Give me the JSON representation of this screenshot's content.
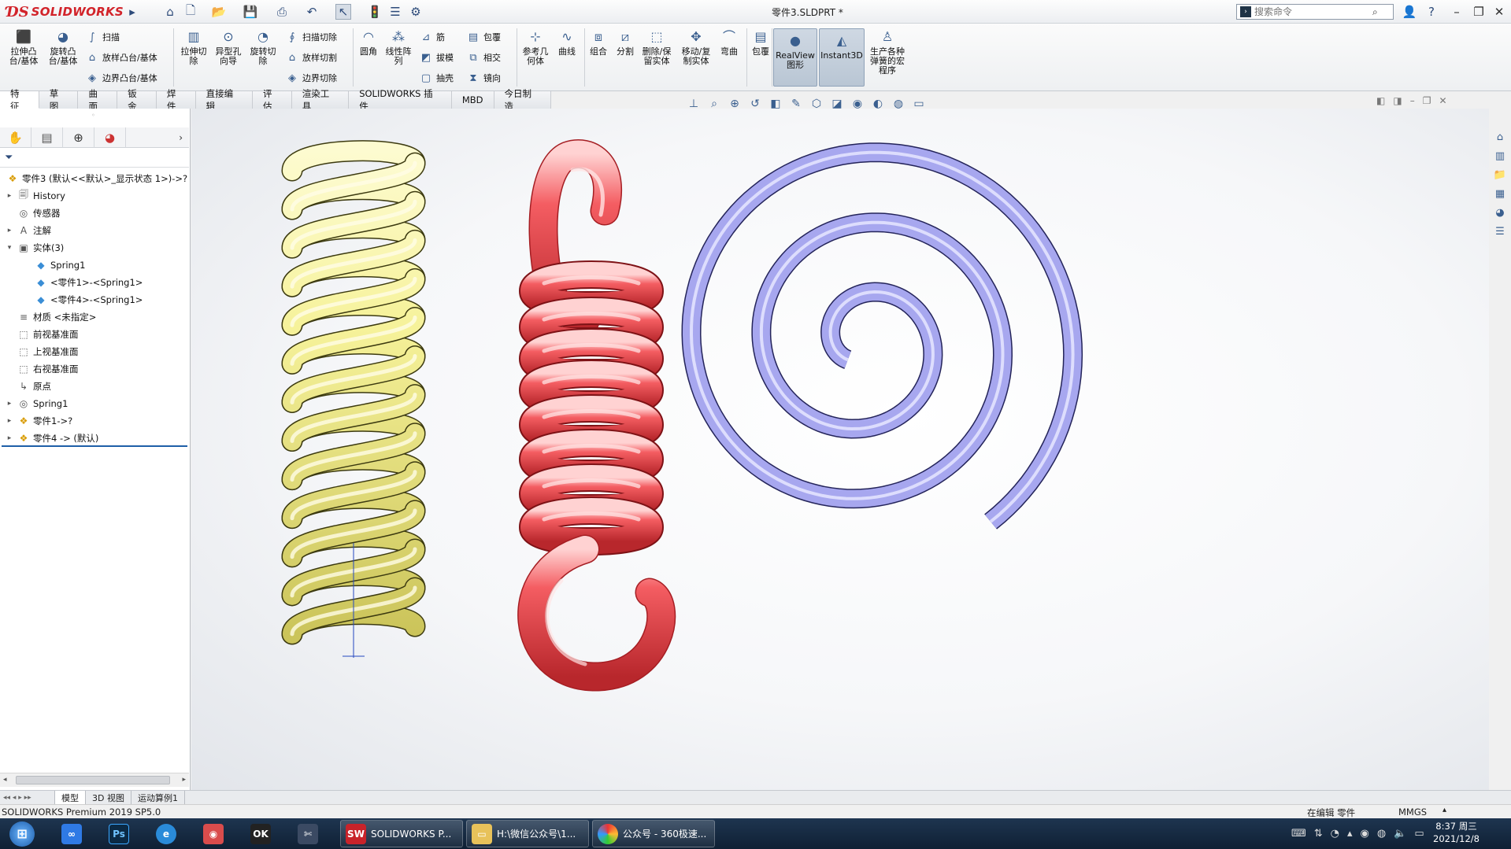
{
  "app": {
    "name": "SOLIDWORKS",
    "doc_title": "零件3.SLDPRT *"
  },
  "search": {
    "placeholder": "搜索命令"
  },
  "commands": {
    "extrude_boss": "拉伸凸台/基体",
    "revolve_boss": "旋转凸台/基体",
    "sweep": "扫描",
    "loft_boss": "放样凸台/基体",
    "boundary_boss": "边界凸台/基体",
    "extrude_cut": "拉伸切除",
    "hole_wizard": "异型孔向导",
    "revolve_cut": "旋转切除",
    "sweep_cut": "扫描切除",
    "loft_cut": "放样切割",
    "boundary_cut": "边界切除",
    "fillet": "圆角",
    "linear_pattern": "线性阵列",
    "rib": "筋",
    "draft": "拔模",
    "shell": "抽壳",
    "wrap": "包覆",
    "intersect": "相交",
    "mirror": "镜向",
    "ref_geometry": "参考几何体",
    "curves": "曲线",
    "combine": "组合",
    "split": "分割",
    "delete_keep_body": "删除/保留实体",
    "move_copy_body": "移动/复制实体",
    "flex": "弯曲",
    "wrap2": "包覆",
    "realview": "RealView图形",
    "instant3d": "Instant3D",
    "spring_program": "生产各种弹簧的宏程序"
  },
  "tabs": [
    "特征",
    "草图",
    "曲面",
    "钣金",
    "焊件",
    "直接编辑",
    "评估",
    "渲染工具",
    "SOLIDWORKS 插件",
    "MBD",
    "今日制造"
  ],
  "tree": {
    "root": "零件3  (默认<<默认>_显示状态 1>)->?",
    "items": [
      {
        "label": "History",
        "arrow": "▸",
        "icon": "history-icon",
        "glyph": "🗐",
        "indent": 0
      },
      {
        "label": "传感器",
        "arrow": "",
        "icon": "sensor-icon",
        "glyph": "◎",
        "indent": 0
      },
      {
        "label": "注解",
        "arrow": "▸",
        "icon": "annotation-icon",
        "glyph": "A",
        "indent": 0
      },
      {
        "label": "实体(3)",
        "arrow": "▾",
        "icon": "solid-bodies-icon",
        "glyph": "▣",
        "indent": 0
      },
      {
        "label": "Spring1",
        "arrow": "",
        "icon": "body-icon",
        "glyph": "◆",
        "indent": 1
      },
      {
        "label": "<零件1>-<Spring1>",
        "arrow": "",
        "icon": "body-icon",
        "glyph": "◆",
        "indent": 1
      },
      {
        "label": "<零件4>-<Spring1>",
        "arrow": "",
        "icon": "body-icon",
        "glyph": "◆",
        "indent": 1
      },
      {
        "label": "材质 <未指定>",
        "arrow": "",
        "icon": "material-icon",
        "glyph": "≡",
        "indent": 0
      },
      {
        "label": "前视基准面",
        "arrow": "",
        "icon": "plane-icon",
        "glyph": "⬚",
        "indent": 0
      },
      {
        "label": "上视基准面",
        "arrow": "",
        "icon": "plane-icon",
        "glyph": "⬚",
        "indent": 0
      },
      {
        "label": "右视基准面",
        "arrow": "",
        "icon": "plane-icon",
        "glyph": "⬚",
        "indent": 0
      },
      {
        "label": "原点",
        "arrow": "",
        "icon": "origin-icon",
        "glyph": "↳",
        "indent": 0
      },
      {
        "label": "Spring1",
        "arrow": "▸",
        "icon": "feature-icon",
        "glyph": "◎",
        "indent": 0
      },
      {
        "label": "零件1->?",
        "arrow": "▸",
        "icon": "part-icon",
        "glyph": "❖",
        "indent": 0
      },
      {
        "label": "零件4 -> (默认)",
        "arrow": "▸",
        "icon": "part-icon",
        "glyph": "❖",
        "indent": 0
      }
    ]
  },
  "bottom_tabs": [
    "模型",
    "3D 视图",
    "运动算例1"
  ],
  "status": {
    "left": "SOLIDWORKS Premium 2019 SP5.0",
    "mode": "在编辑 零件",
    "units": "MMGS"
  },
  "taskbar": {
    "apps": [
      "SOLIDWORKS P...",
      "H:\\微信公众号\\1...",
      "公众号 - 360极速..."
    ],
    "time": "8:37 周三",
    "date": "2021/12/8"
  },
  "colors": {
    "compression_spring": "#f6f29a",
    "extension_spring": "#ee4a4f",
    "spiral_spring": "#a7a7ef",
    "accent": "#1e5fa8"
  }
}
